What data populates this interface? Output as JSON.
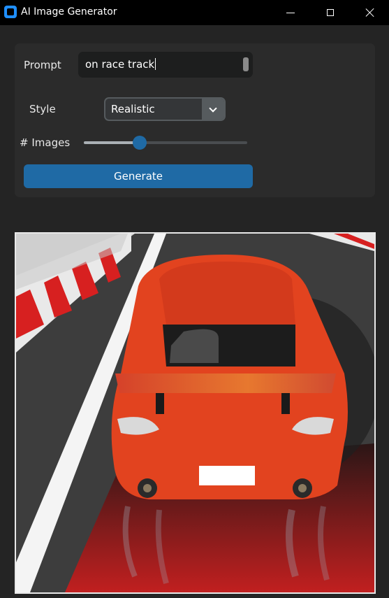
{
  "window": {
    "title": "AI Image Generator",
    "icon": "app-icon"
  },
  "form": {
    "prompt_label": "Prompt",
    "prompt_value": "on race track",
    "style_label": "Style",
    "style_value": "Realistic",
    "images_label": "# Images",
    "images_slider_fraction": 0.34,
    "generate_label": "Generate"
  },
  "colors": {
    "accent": "#1f6aa5",
    "background": "#242424",
    "panel": "#2b2b2b"
  }
}
